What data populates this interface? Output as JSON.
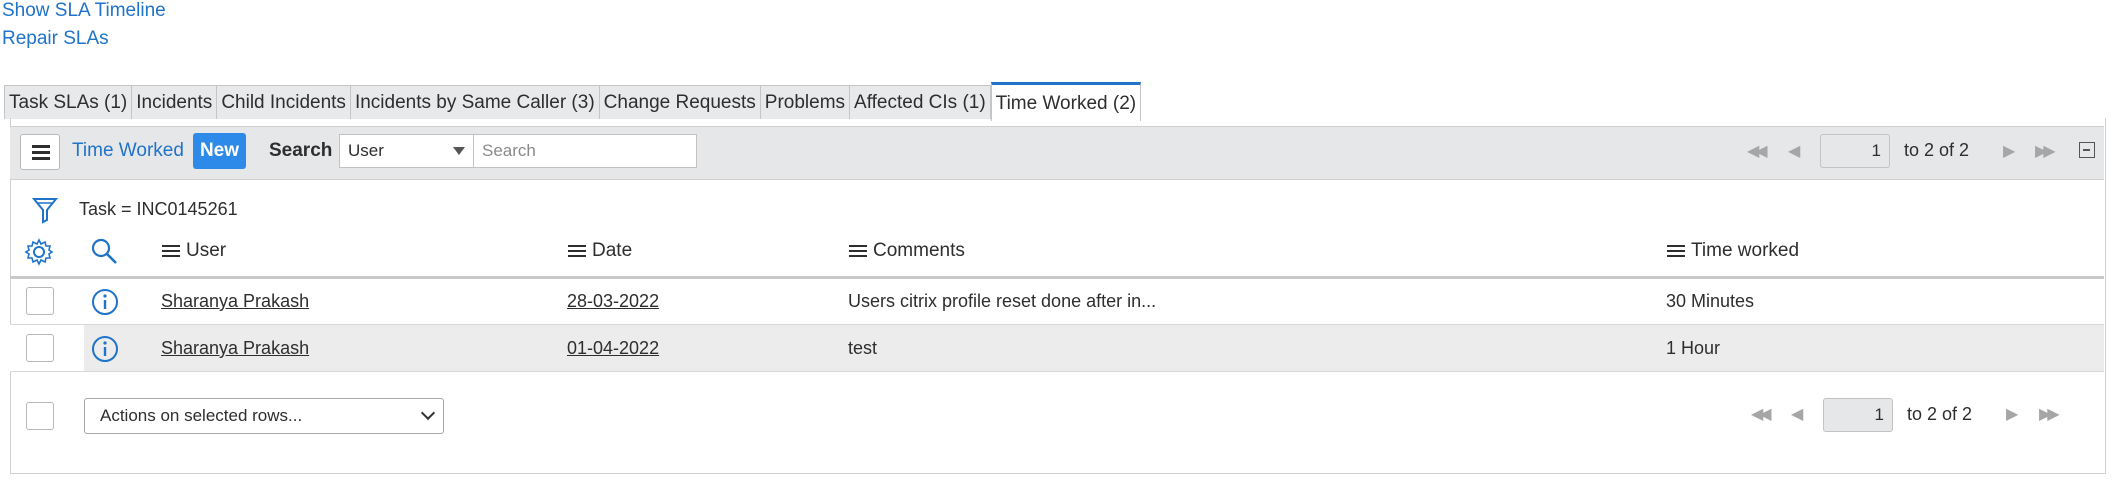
{
  "links": {
    "show_sla_timeline": "Show SLA Timeline",
    "repair_slas": "Repair SLAs"
  },
  "tabs": [
    {
      "label": "Task SLAs (1)"
    },
    {
      "label": "Incidents"
    },
    {
      "label": "Child Incidents"
    },
    {
      "label": "Incidents by Same Caller (3)"
    },
    {
      "label": "Change Requests"
    },
    {
      "label": "Problems"
    },
    {
      "label": "Affected CIs (1)"
    },
    {
      "label": "Time Worked (2)",
      "active": true
    }
  ],
  "toolbar": {
    "title": "Time Worked",
    "new_label": "New",
    "search_label": "Search",
    "search_field_selected": "User",
    "search_placeholder": "Search",
    "page": "1",
    "page_range": "to 2 of 2"
  },
  "filter": {
    "text": "Task = INC0145261"
  },
  "columns": {
    "user": "User",
    "date": "Date",
    "comments": "Comments",
    "time_worked": "Time worked"
  },
  "rows": [
    {
      "user": "Sharanya Prakash",
      "date": "28-03-2022",
      "comments": "Users citrix profile reset done after in...",
      "time_worked": "30 Minutes"
    },
    {
      "user": "Sharanya Prakash",
      "date": "01-04-2022",
      "comments": "test",
      "time_worked": "1 Hour"
    }
  ],
  "footer": {
    "actions_placeholder": "Actions on selected rows...",
    "page": "1",
    "page_range": "to 2 of 2"
  },
  "colors": {
    "link": "#1f73c9",
    "new_button": "#2d8ae8",
    "toolbar_bg": "#e6e7e8"
  }
}
